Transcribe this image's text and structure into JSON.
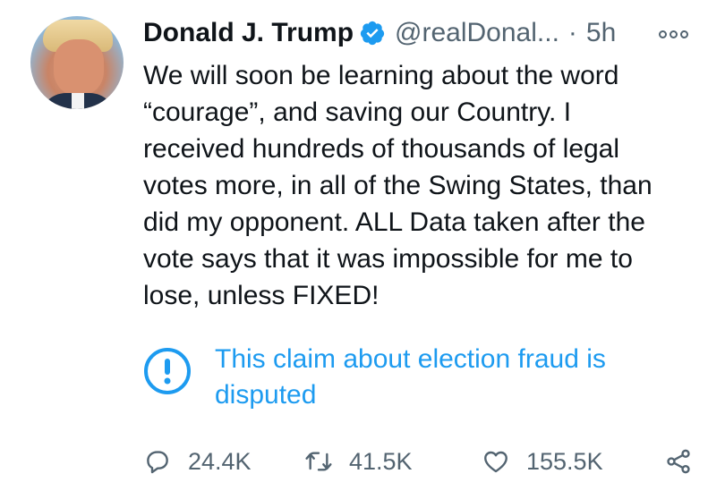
{
  "tweet": {
    "author_name": "Donald J. Trump",
    "handle": "@realDonal...",
    "separator": "·",
    "time": "5h",
    "text": "We will soon be learning about the word\n“courage”, and saving our Country. I\nreceived hundreds of thousands of legal\nvotes more, in all of the Swing States, than\ndid my opponent.   ALL Data taken after the\nvote says that it was impossible for me to\nlose, unless FIXED!"
  },
  "notice": {
    "text": "This claim about election fraud is disputed",
    "icon": "exclamation-circle-icon"
  },
  "actions": {
    "replies": "24.4K",
    "retweets": "41.5K",
    "likes": "155.5K"
  },
  "colors": {
    "accent": "#1d9bf0",
    "text": "#0f1419",
    "muted": "#536471"
  }
}
